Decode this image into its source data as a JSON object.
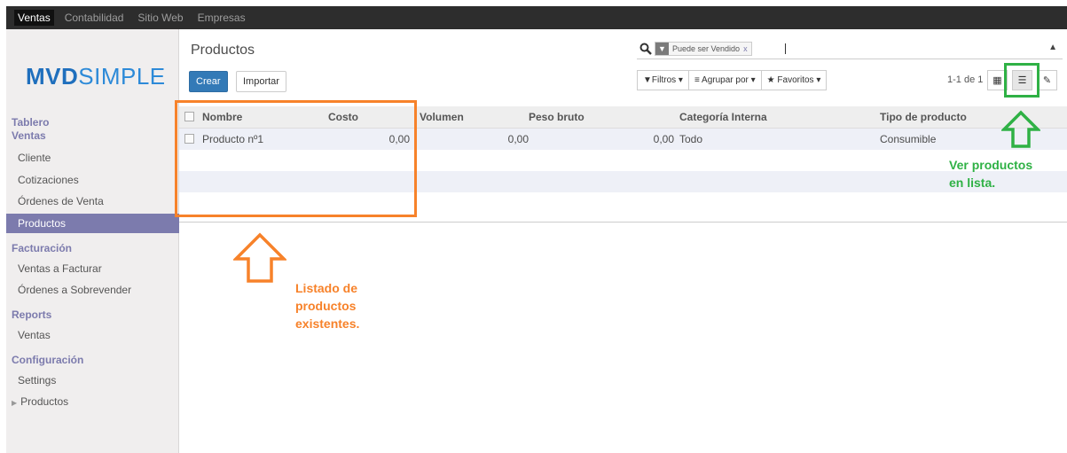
{
  "topbar": {
    "items": [
      "Ventas",
      "Contabilidad",
      "Sitio Web",
      "Empresas"
    ],
    "active_index": 0
  },
  "sidebar": {
    "logo_bold": "MVD",
    "logo_light": "SIMPLE",
    "headings": {
      "tablero": "Tablero",
      "ventas": "Ventas",
      "facturacion": "Facturación",
      "reports": "Reports",
      "configuracion": "Configuración"
    },
    "items": {
      "cliente": "Cliente",
      "cotizaciones": "Cotizaciones",
      "ordenes_venta": "Órdenes de Venta",
      "productos": "Productos",
      "ventas_a_facturar": "Ventas a Facturar",
      "ordenes_a_sobrevender": "Órdenes a Sobrevender",
      "reports_ventas": "Ventas",
      "settings": "Settings",
      "config_productos": "Productos"
    },
    "active_item": "productos"
  },
  "control_panel": {
    "title": "Productos",
    "create_label": "Crear",
    "import_label": "Importar",
    "search_facet": "Puede ser Vendido",
    "search_facet_remove": "x",
    "filters_label": "Filtros",
    "group_by_label": "Agrupar por",
    "favorites_label": "Favoritos",
    "pager": "1-1 de 1"
  },
  "table": {
    "columns": [
      "Nombre",
      "Costo",
      "Volumen",
      "Peso bruto",
      "Categoría Interna",
      "Tipo de producto"
    ],
    "rows": [
      {
        "nombre": "Producto nº1",
        "costo": "0,00",
        "volumen": "0,00",
        "peso_bruto": "0,00",
        "categoria": "Todo",
        "tipo": "Consumible"
      }
    ]
  },
  "annotations": {
    "list_note": [
      "Listado de",
      "productos",
      "existentes."
    ],
    "view_note": [
      "Ver productos",
      "en lista."
    ]
  },
  "colors": {
    "accent": "#7c7bad",
    "primary_button": "#337ab7",
    "annotation_orange": "#f7822a",
    "annotation_green": "#2fb145"
  }
}
